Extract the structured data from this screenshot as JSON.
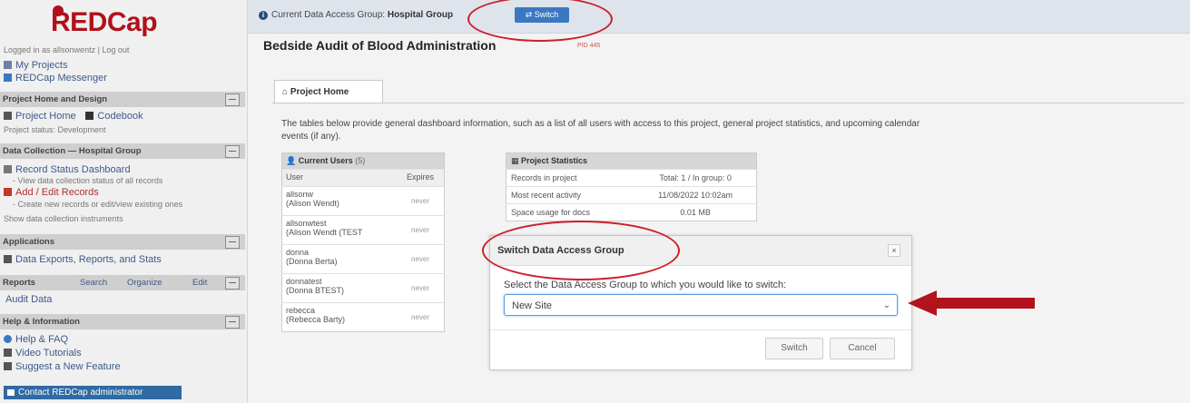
{
  "sidebar": {
    "logo": "REDCap",
    "logged_in": "Logged in as allsonwentz | Log out",
    "my_projects": "My Projects",
    "messenger": "REDCap Messenger",
    "sections": {
      "project_home": "Project Home and Design",
      "data_collection": "Data Collection — Hospital Group",
      "applications": "Applications",
      "reports": "Reports",
      "help": "Help & Information"
    },
    "project_home_link": "Project Home",
    "codebook_link": "Codebook",
    "project_status": "Project status: Development",
    "record_status_dashboard": "Record Status Dashboard",
    "rsd_hint": "- View data collection status of all records",
    "add_edit_records": "Add / Edit Records",
    "aer_hint": "- Create new records or edit/view existing ones",
    "show_instruments": "Show data collection instruments",
    "data_exports": "Data Exports, Reports, and Stats",
    "reports_search": "Search",
    "reports_organize": "Organize",
    "reports_edit": "Edit",
    "audit_data": "Audit Data",
    "help_faq": "Help & FAQ",
    "video_tutorials": "Video Tutorials",
    "suggest_feature": "Suggest a New Feature",
    "contact_admin": "Contact REDCap administrator"
  },
  "topbar": {
    "current_dag_label": "Current Data Access Group:",
    "current_dag_value": "Hospital Group",
    "switch_label": "Switch"
  },
  "main": {
    "project_title": "Bedside Audit of Blood Administration",
    "pid": "PID 445",
    "tab_label": "Project Home",
    "intro": "The tables below provide general dashboard information, such as a list of all users with access to this project, general project statistics, and upcoming calendar events (if any).",
    "users_table": {
      "title": "Current Users",
      "count": "(5)",
      "col_user": "User",
      "col_expires": "Expires",
      "rows": [
        {
          "user": "allsonw",
          "name": "(Alison Wendt)",
          "expires": "never"
        },
        {
          "user": "allsonwtest",
          "name": "(Alison Wendt (TEST",
          "expires": "never"
        },
        {
          "user": "donna",
          "name": "(Donna Berta)",
          "expires": "never"
        },
        {
          "user": "donnatest",
          "name": "(Donna BTEST)",
          "expires": "never"
        },
        {
          "user": "rebecca",
          "name": "(Rebecca Barty)",
          "expires": "never"
        }
      ]
    },
    "stats_table": {
      "title": "Project Statistics",
      "rows": [
        {
          "label": "Records in project",
          "value": "Total: 1 / In group: 0"
        },
        {
          "label": "Most recent activity",
          "value": "11/08/2022 10:02am"
        },
        {
          "label": "Space usage for docs",
          "value": "0.01 MB"
        }
      ]
    }
  },
  "dialog": {
    "title": "Switch Data Access Group",
    "close": "×",
    "label": "Select the Data Access Group to which you would like to switch:",
    "selected_option": "New Site",
    "switch_button": "Switch",
    "cancel_button": "Cancel"
  },
  "colors": {
    "accent_blue": "#3a78c2",
    "annotation_red": "#cc1f2a",
    "brand_red": "#b0111b"
  }
}
